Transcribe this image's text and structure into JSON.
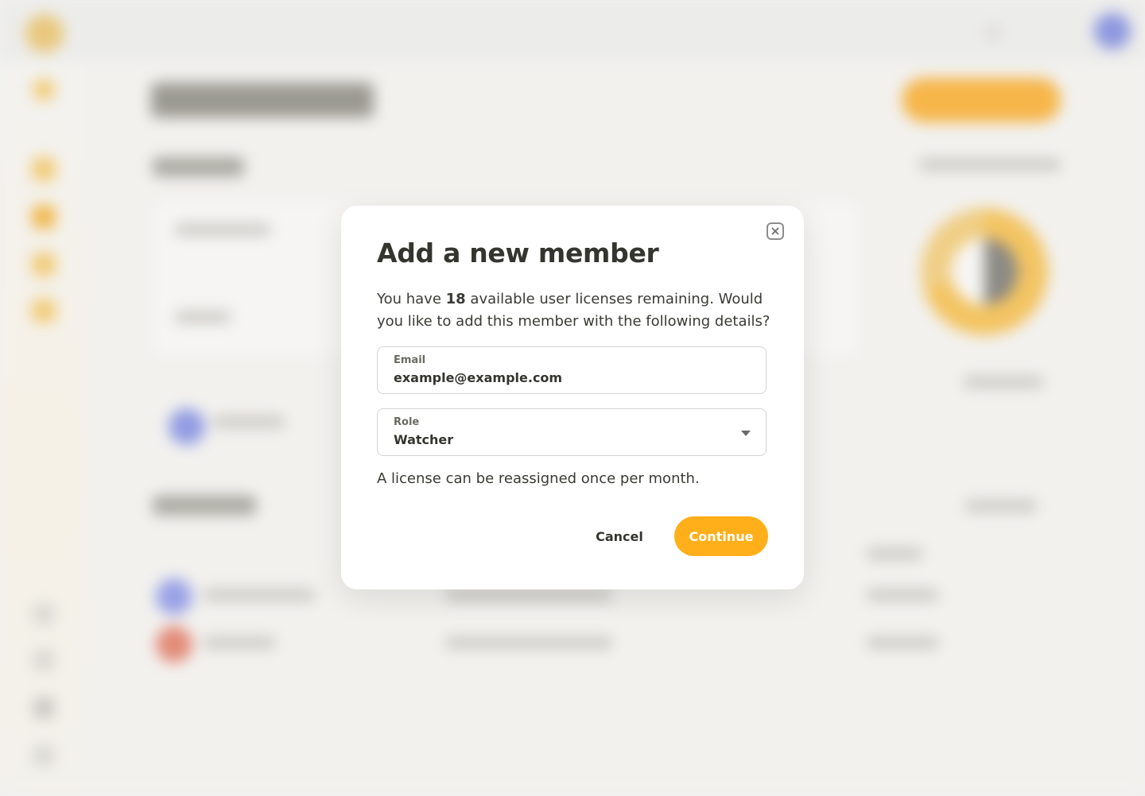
{
  "modal": {
    "title": "Add a new member",
    "description_prefix": "You have ",
    "license_count": "18",
    "description_suffix": " available user licenses remaining. Would you like to add this member with the following details?",
    "email": {
      "label": "Email",
      "value": "example@example.com"
    },
    "role": {
      "label": "Role",
      "selected": "Watcher"
    },
    "note": "A license can be reassigned once per month.",
    "cancel_label": "Cancel",
    "continue_label": "Continue"
  },
  "icons": {
    "close": "close-icon",
    "role_dropdown": "chevron-down-icon"
  },
  "colors": {
    "accent": "#ffaf1a",
    "text": "#34352e",
    "backdrop": "#f1f0ee"
  }
}
